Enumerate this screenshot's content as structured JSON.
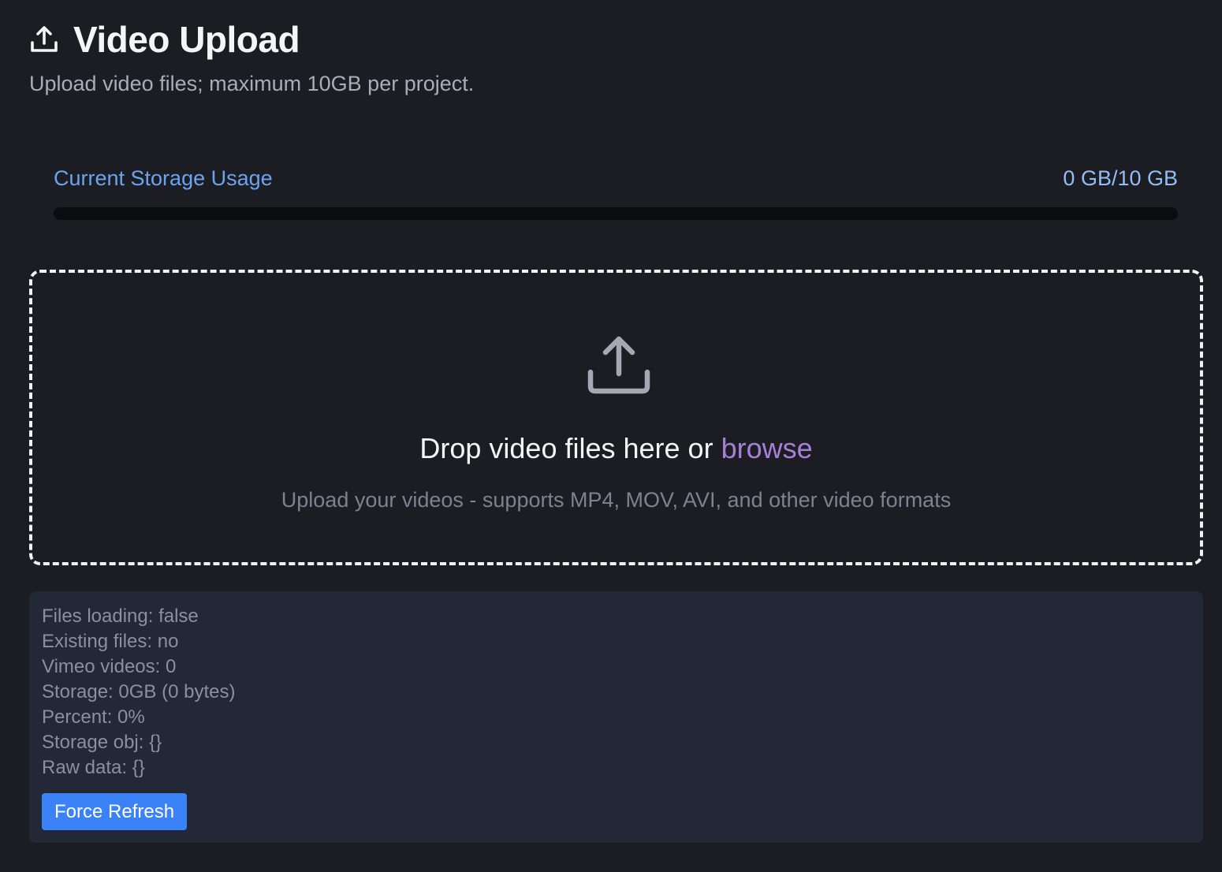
{
  "header": {
    "icon": "upload-icon",
    "title": "Video Upload",
    "subtitle": "Upload video files; maximum 10GB per project."
  },
  "storage": {
    "label": "Current Storage Usage",
    "value_text": "0 GB/10 GB",
    "percent_used": 0
  },
  "dropzone": {
    "icon": "upload-tray-icon",
    "title_prefix": "Drop video files here or ",
    "browse_label": "browse",
    "hint": "Upload your videos - supports MP4, MOV, AVI, and other video formats"
  },
  "debug": {
    "lines": [
      "Files loading: false",
      "Existing files: no",
      "Vimeo videos: 0",
      "Storage: 0GB (0 bytes)",
      "Percent: 0%",
      "Storage obj: {}",
      "Raw data: {}"
    ],
    "refresh_label": "Force Refresh"
  },
  "colors": {
    "background": "#1c1d22",
    "accent_blue": "#3b82f6",
    "link_blue": "#6aa4f0",
    "browse_purple": "#a680d8",
    "debug_panel": "#232836"
  }
}
